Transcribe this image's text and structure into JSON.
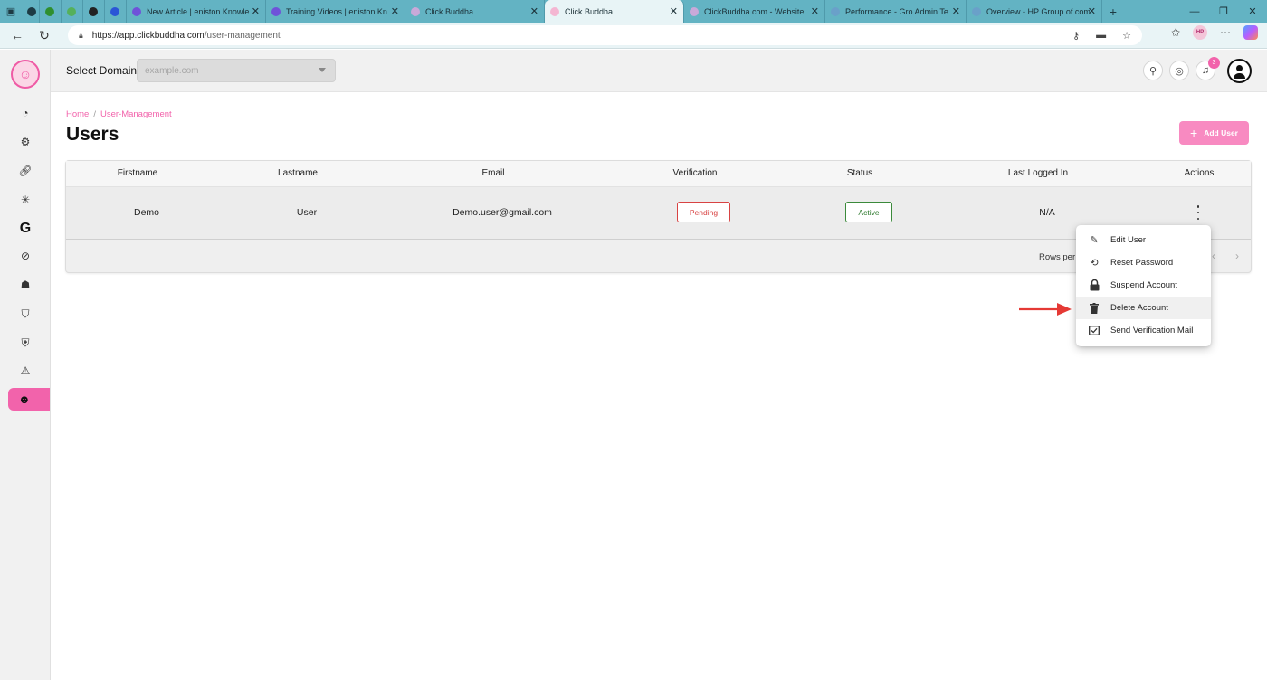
{
  "browser": {
    "tabs": [
      {
        "title": "",
        "favicon_color": "#1d3b44"
      },
      {
        "title": "",
        "favicon_color": "#2f8f2f"
      },
      {
        "title": "",
        "favicon_color": "#55b05a"
      },
      {
        "title": "",
        "favicon_color": "#222222"
      },
      {
        "title": "",
        "favicon_color": "#2b55d6"
      },
      {
        "title": "New Article | eniston Knowle",
        "favicon_color": "#6f52d9"
      },
      {
        "title": "Training Videos | eniston Kn",
        "favicon_color": "#6f52d9"
      },
      {
        "title": "Click Buddha",
        "favicon_color": "#c9a9d9"
      },
      {
        "title": "Click Buddha",
        "favicon_color": "#f4b6d2"
      },
      {
        "title": "ClickBuddha.com - Website",
        "favicon_color": "#c9a9d9"
      },
      {
        "title": "Performance - Gro Admin Te",
        "favicon_color": "#6aa0c9"
      },
      {
        "title": "Overview - HP Group of com",
        "favicon_color": "#6aa0c9"
      }
    ],
    "url_host": "https://app.clickbuddha.com",
    "url_path": "/user-management",
    "profile_badge": "HP"
  },
  "header": {
    "select_domain_label": "Select Domain",
    "domain_placeholder": "example.com",
    "notification_count": "3"
  },
  "breadcrumb": {
    "home": "Home",
    "separator": "/",
    "current": "User-Management"
  },
  "page": {
    "title": "Users",
    "add_user_label": "Add User"
  },
  "table": {
    "columns": [
      "Firstname",
      "Lastname",
      "Email",
      "Verification",
      "Status",
      "Last Logged In",
      "Actions"
    ],
    "rows": [
      {
        "firstname": "Demo",
        "lastname": "User",
        "email": "Demo.user@gmail.com",
        "verification": "Pending",
        "status": "Active",
        "last_logged_in": "N/A"
      }
    ],
    "rows_per_page_label": "Rows per"
  },
  "actions_menu": {
    "items": [
      "Edit User",
      "Reset Password",
      "Suspend Account",
      "Delete Account",
      "Send Verification Mail"
    ],
    "highlighted": "Delete Account"
  },
  "colors": {
    "accent": "#f263ab",
    "pending": "#d84343",
    "active": "#2f7a2f",
    "annotation_arrow": "#e53935"
  }
}
